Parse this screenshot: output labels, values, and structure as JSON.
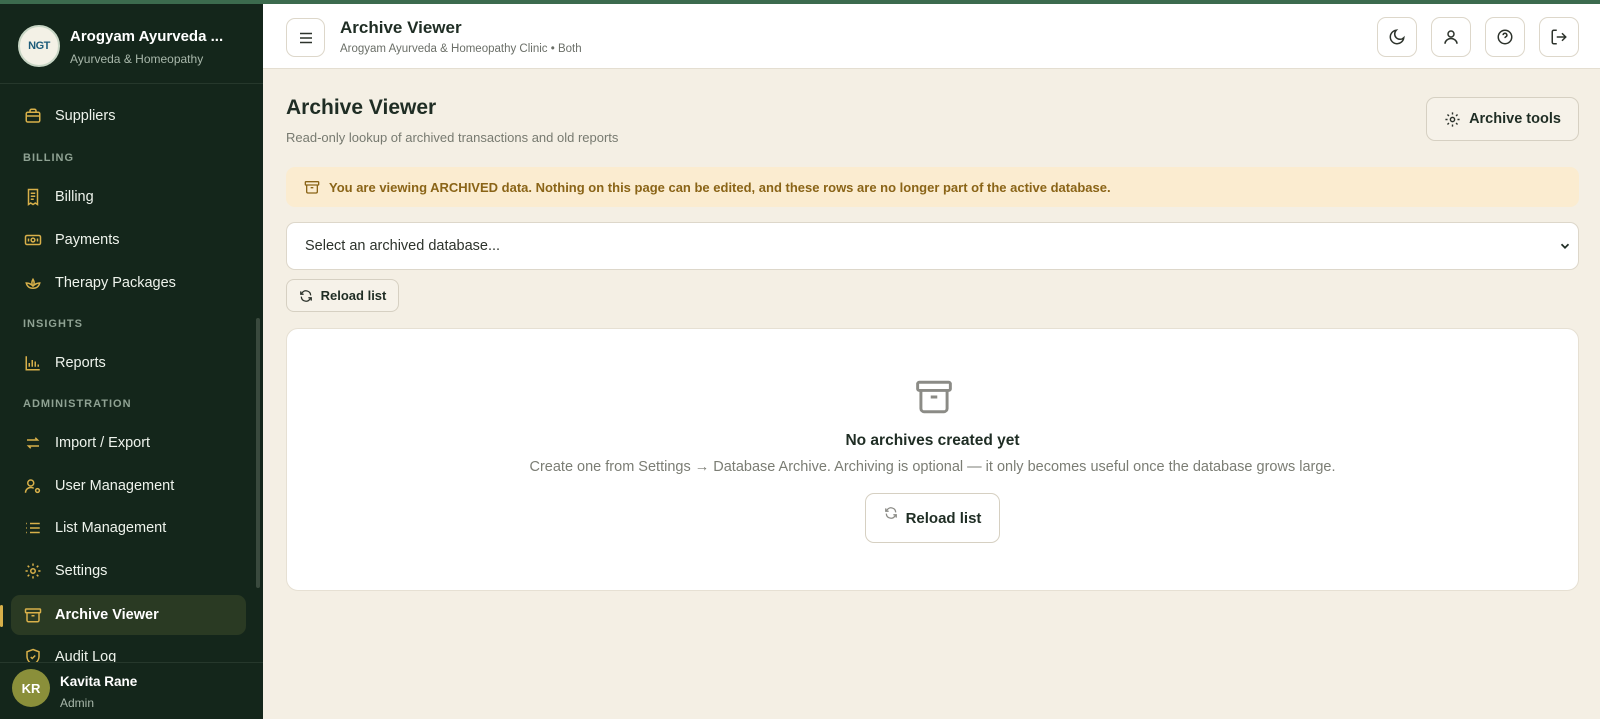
{
  "brand": {
    "logo_text": "NGT",
    "name": "Arogyam Ayurveda ...",
    "subtitle": "Ayurveda & Homeopathy"
  },
  "sidebar": {
    "items": [
      {
        "label": "Suppliers",
        "icon": "briefcase-icon"
      },
      {
        "section": "BILLING"
      },
      {
        "label": "Billing",
        "icon": "receipt-icon"
      },
      {
        "label": "Payments",
        "icon": "cash-icon"
      },
      {
        "label": "Therapy Packages",
        "icon": "lotus-icon"
      },
      {
        "section": "INSIGHTS"
      },
      {
        "label": "Reports",
        "icon": "bar-chart-icon"
      },
      {
        "section": "ADMINISTRATION"
      },
      {
        "label": "Import / Export",
        "icon": "arrows-swap-icon"
      },
      {
        "label": "User Management",
        "icon": "user-cog-icon"
      },
      {
        "label": "List Management",
        "icon": "list-icon"
      },
      {
        "label": "Settings",
        "icon": "gear-icon"
      },
      {
        "label": "Archive Viewer",
        "icon": "archive-icon",
        "active": true
      },
      {
        "label": "Audit Log",
        "icon": "shield-check-icon"
      }
    ]
  },
  "user": {
    "initials": "KR",
    "name": "Kavita Rane",
    "role": "Admin"
  },
  "header": {
    "title": "Archive Viewer",
    "subtitle": "Arogyam Ayurveda & Homeopathy Clinic • Both"
  },
  "main": {
    "title": "Archive Viewer",
    "subtitle": "Read-only lookup of archived transactions and old reports",
    "tools_label": "Archive tools",
    "alert": "You are viewing ARCHIVED data. Nothing on this page can be edited, and these rows are no longer part of the active database.",
    "select_placeholder": "Select an archived database...",
    "reload_label": "Reload list",
    "empty_title": "No archives created yet",
    "empty_desc": "Create one from Settings → Database Archive. Archiving is optional — it only becomes useful once the database grows large.",
    "empty_reload_label": "Reload list"
  },
  "colors": {
    "sidebar_bg": "#14261b",
    "accent": "#3c6b4e",
    "active_bar": "#d8b04a",
    "alert_bg": "#fbecd0",
    "alert_text": "#8a6417",
    "page_bg": "#f4efe4"
  }
}
